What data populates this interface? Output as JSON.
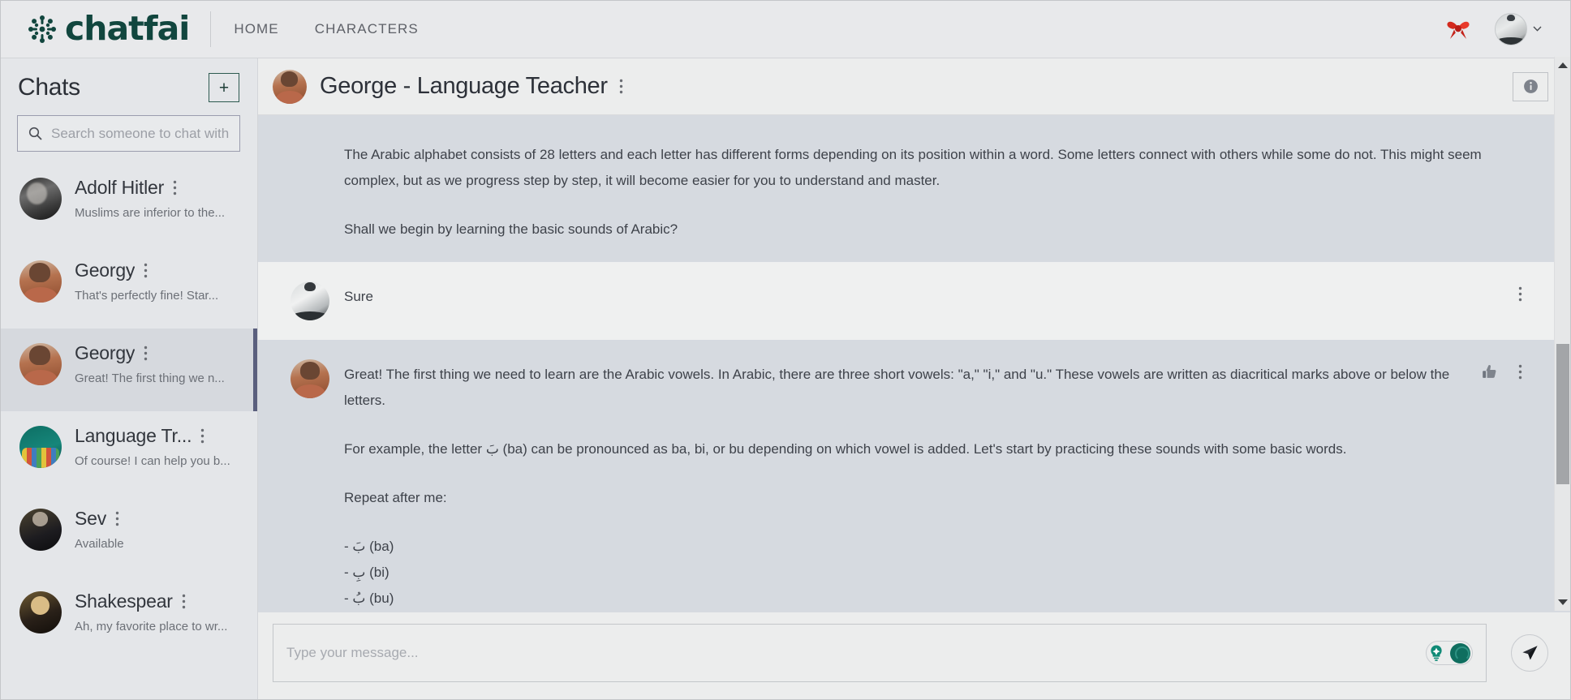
{
  "brand": {
    "name": "chatfai",
    "logo_icon": "chatfai-logo-icon"
  },
  "nav": {
    "links": [
      {
        "label": "HOME",
        "name": "nav-home"
      },
      {
        "label": "CHARACTERS",
        "name": "nav-characters"
      }
    ],
    "gift_icon": "red-bow-icon",
    "avatar_icon": "user-avatar",
    "chevron_icon": "chevron-down-icon"
  },
  "sidebar": {
    "title": "Chats",
    "add_label": "+",
    "search": {
      "placeholder": "Search someone to chat with",
      "value": "",
      "icon": "search-icon"
    },
    "chats": [
      {
        "name": "Adolf Hitler",
        "preview": "Muslims are inferior to the...",
        "avatar": "av-hitler",
        "selected": false
      },
      {
        "name": "Georgy",
        "preview": "That's perfectly fine! Star...",
        "avatar": "av-georgy",
        "selected": false
      },
      {
        "name": "Georgy",
        "preview": "Great! The first thing we n...",
        "avatar": "av-georgy",
        "selected": true
      },
      {
        "name": "Language Tr...",
        "preview": "Of course! I can help you b...",
        "avatar": "av-teacher",
        "selected": false
      },
      {
        "name": "Sev",
        "preview": "Available",
        "avatar": "av-sev",
        "selected": false
      },
      {
        "name": "Shakespear",
        "preview": "Ah, my favorite place to wr...",
        "avatar": "av-shake",
        "selected": false
      }
    ]
  },
  "chat": {
    "header": {
      "title": "George - Language Teacher",
      "menu_icon": "kebab-menu-icon",
      "info_icon": "info-icon"
    },
    "messages": [
      {
        "role": "bot",
        "avatar": "av-georgy",
        "show_avatar": false,
        "paragraphs": [
          "The Arabic alphabet consists of 28 letters and each letter has different forms depending on its position within a word. Some letters connect with others while some do not. This might seem complex, but as we progress step by step, it will become easier for you to understand and master.",
          "Shall we begin by learning the basic sounds of Arabic?"
        ],
        "actions": []
      },
      {
        "role": "user",
        "avatar": "av-map",
        "show_avatar": true,
        "paragraphs": [
          "Sure"
        ],
        "actions": [
          "kebab-menu-icon"
        ]
      },
      {
        "role": "bot",
        "avatar": "av-georgy",
        "show_avatar": true,
        "paragraphs": [
          "Great! The first thing we need to learn are the Arabic vowels. In Arabic, there are three short vowels: \"a,\" \"i,\" and \"u.\" These vowels are written as diacritical marks above or below the letters.",
          "For example, the letter بَ (ba) can be pronounced as ba, bi, or bu depending on which vowel is added. Let's start by practicing these sounds with some basic words.",
          "Repeat after me:",
          "- بَ (ba)",
          "- بِ (bi)",
          "- بُ (bu)"
        ],
        "actions": [
          "thumbs-up-icon",
          "kebab-menu-icon"
        ]
      }
    ]
  },
  "composer": {
    "placeholder": "Type your message...",
    "value": "",
    "bulb_icon": "lightbulb-icon",
    "toggle_state": "on",
    "send_icon": "send-icon"
  },
  "colors": {
    "brand_green": "#11463e",
    "toggle_green": "#0f6e5f",
    "bot_message_bg": "#d6dae0",
    "user_message_bg": "#eff0f0",
    "selected_chat_bg": "#d6d9de",
    "selection_bar": "#5a5f7d",
    "gift_red": "#d32a1e"
  }
}
